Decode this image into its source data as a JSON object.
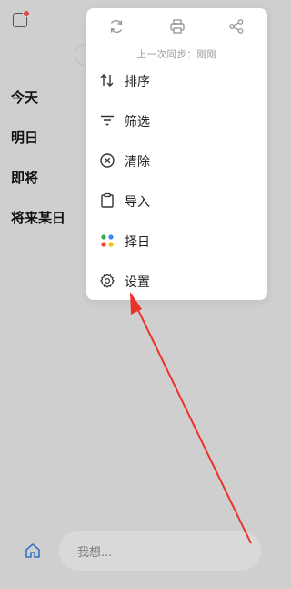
{
  "sections": [
    "今天",
    "明日",
    "即将",
    "将来某日"
  ],
  "popup": {
    "sync_label": "上一次同步：",
    "sync_value": "刚刚",
    "top_icons": [
      "sync-icon",
      "print-icon",
      "share-icon"
    ],
    "items": [
      {
        "label": "排序",
        "icon": "sort-icon"
      },
      {
        "label": "筛选",
        "icon": "filter-icon"
      },
      {
        "label": "清除",
        "icon": "clear-icon"
      },
      {
        "label": "导入",
        "icon": "import-icon"
      },
      {
        "label": "择日",
        "icon": "pick-date-icon"
      },
      {
        "label": "设置",
        "icon": "settings-icon"
      }
    ]
  },
  "bottom": {
    "input_placeholder": "我想..."
  },
  "colors": {
    "badge": "#e0454b",
    "annotation_arrow": "#e8352b",
    "home_icon": "#3a72c4"
  }
}
